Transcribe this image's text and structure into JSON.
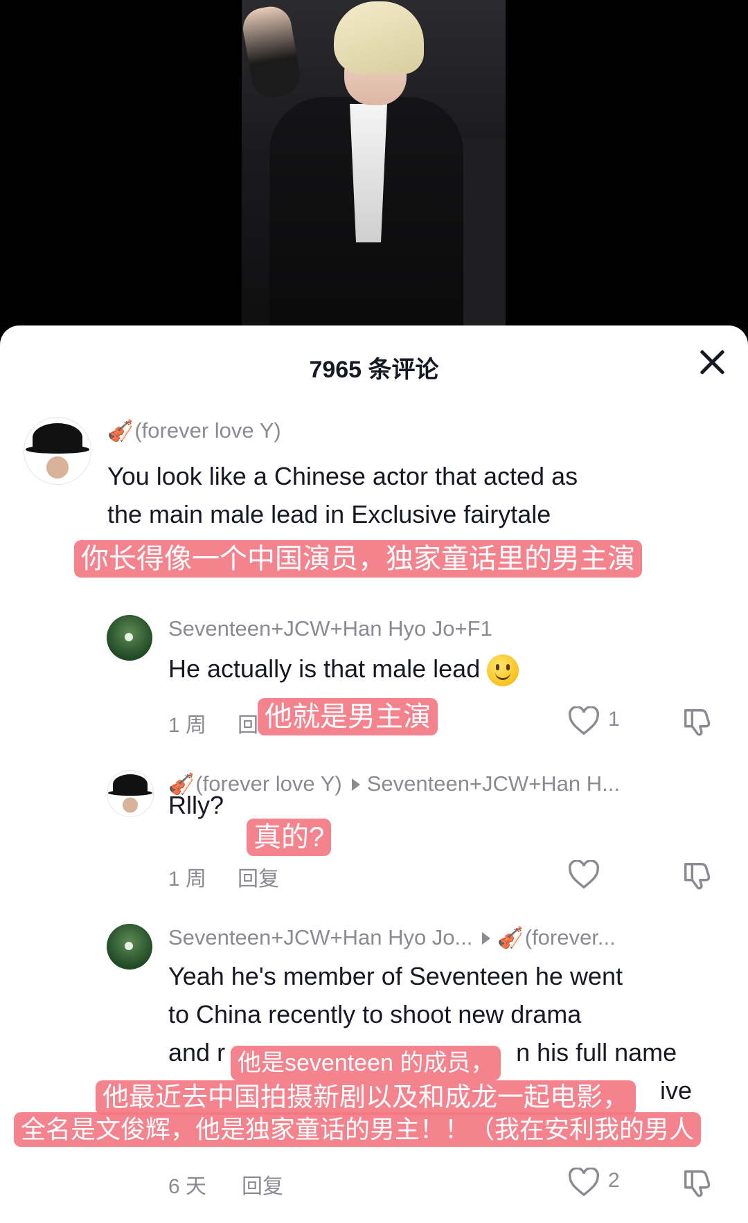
{
  "sheet": {
    "title": "7965 条评论"
  },
  "comments": [
    {
      "user": "(forever love Y)",
      "user_emoji": "🎻",
      "lines": [
        "You look like a Chinese actor that acted as",
        "the main male lead in Exclusive fairytale"
      ],
      "caption": "你长得像一个中国演员，独家童话里的男主演"
    },
    {
      "user": "Seventeen+JCW+Han Hyo Jo+F1",
      "text": "He actually is that male lead",
      "time": "1 周",
      "reply": "回",
      "likes": "1",
      "caption": "他就是男主演"
    },
    {
      "user": "(forever love Y)",
      "user_emoji": "🎻",
      "reply_to": "Seventeen+JCW+Han H...",
      "text": "Rlly?",
      "time": "1 周",
      "reply": "回复",
      "caption": "真的?"
    },
    {
      "user": "Seventeen+JCW+Han Hyo Jo...",
      "reply_to_emoji": "🎻",
      "reply_to": "(forever...",
      "lines": [
        "Yeah he's member of Seventeen he went",
        "to China recently to shoot new drama",
        "and r",
        "n his full name",
        "ive"
      ],
      "time": "6 天",
      "reply": "回复",
      "likes": "2",
      "captions": [
        "他是seventeen 的成员，",
        "他最近去中国拍摄新剧以及和成龙一起电影，",
        "全名是文俊辉，他是独家童话的男主！！（我在安利我的男人"
      ]
    }
  ],
  "colors": {
    "caption_bg": "#f47884",
    "text": "#161823",
    "muted": "#8a8b91"
  },
  "icons": [
    "close-icon",
    "heart-icon",
    "dislike-icon",
    "violin-icon",
    "smiley-icon",
    "arrow-right-icon"
  ]
}
